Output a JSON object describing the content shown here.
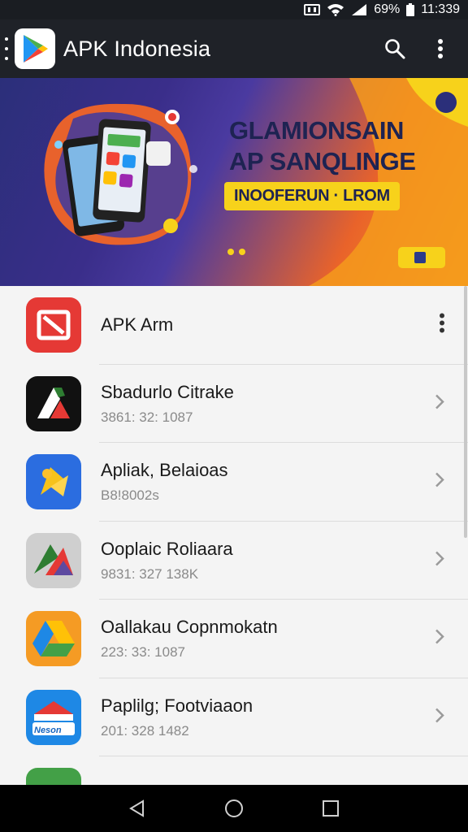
{
  "status_bar": {
    "battery": "69%",
    "time": "11:339"
  },
  "app_bar": {
    "title": "APK Indonesia"
  },
  "banner": {
    "line1": "GLAMIONSAIN",
    "line2": "AP SANQLINGE",
    "tagline": "INOOFERUN · LROM"
  },
  "list": {
    "items": [
      {
        "name": "APK Arm",
        "sub": "",
        "trail": "more"
      },
      {
        "name": "Sbadurlo Citrake",
        "sub": "3861: 32: 1087",
        "trail": "chevron"
      },
      {
        "name": "Apliak, Belaioas",
        "sub": "B8!8002s",
        "trail": "chevron"
      },
      {
        "name": "Ooplaic Roliaara",
        "sub": "9831: 327 138K",
        "trail": "chevron"
      },
      {
        "name": "Oallakau Copnmokatn",
        "sub": "223: 33: 1087",
        "trail": "chevron"
      },
      {
        "name": "Paplilg; Footviaaon",
        "sub": "201: 328 1482",
        "trail": "chevron"
      }
    ],
    "icon6_label": "Neson",
    "icon_colors": [
      "#e53935",
      "#111111",
      "#2b6de0",
      "#9e9e9e",
      "#f59b24",
      "#1565c0"
    ]
  },
  "icons": {
    "status": [
      "wifi-icon",
      "signal-icon",
      "battery-icon"
    ],
    "appbar": [
      "search-icon",
      "overflow-menu-icon"
    ],
    "nav": [
      "back-icon",
      "home-icon",
      "recents-icon"
    ]
  }
}
